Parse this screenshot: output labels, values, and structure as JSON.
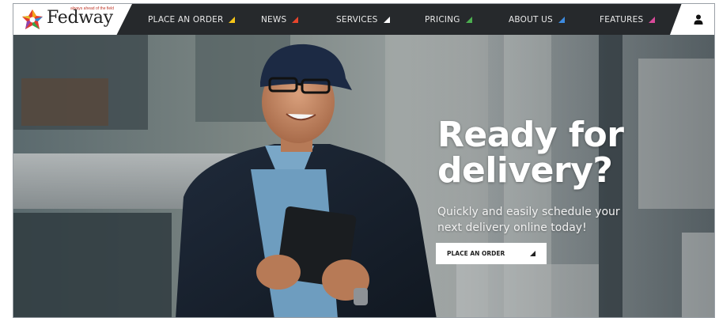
{
  "navbar": {
    "logo": {
      "text": "Fedway",
      "tagline": "always ahead of the field",
      "icon": "fedway-star-logo-icon"
    },
    "items": [
      {
        "label": "PLACE AN ORDER",
        "accent": "#f5c518"
      },
      {
        "label": "NEWS",
        "accent": "#e8452c"
      },
      {
        "label": "SERVICES",
        "accent": "#ffffff"
      },
      {
        "label": "PRICING",
        "accent": "#4caf50"
      },
      {
        "label": "ABOUT US",
        "accent": "#3d8be0"
      },
      {
        "label": "FEATURES",
        "accent": "#d94a9a"
      }
    ],
    "user_icon": "user-icon"
  },
  "hero": {
    "headline_line1": "Ready for",
    "headline_line2": "delivery?",
    "subline_line1": "Quickly and easily schedule your",
    "subline_line2": "next delivery online today!",
    "cta_label": "PLACE AN ORDER"
  },
  "colors": {
    "navbar_bg": "#26292c",
    "cta_bg": "#ffffff"
  }
}
